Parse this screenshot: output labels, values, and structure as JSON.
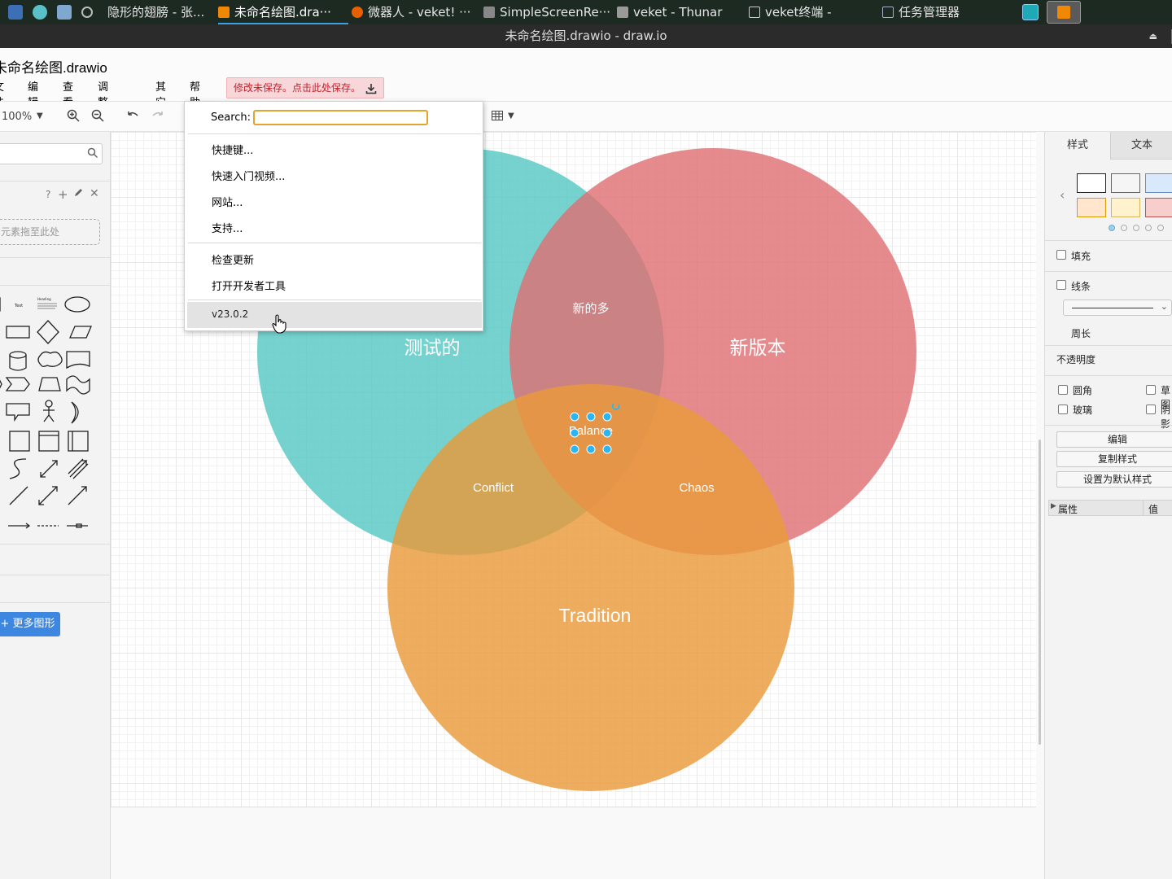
{
  "taskbar": {
    "tasks": [
      {
        "label": "隐形的翅膀 - 张..."
      },
      {
        "label": "未命名绘图.dra···"
      },
      {
        "label": "微器人 - veket! ···"
      },
      {
        "label": "SimpleScreenRe···"
      },
      {
        "label": "veket - Thunar"
      },
      {
        "label": "veket终端 -"
      },
      {
        "label": "任务管理器"
      }
    ]
  },
  "window": {
    "title": "未命名绘图.drawio - draw.io",
    "eject": "⏏"
  },
  "app": {
    "doc_title": "未命名绘图.drawio",
    "menu": [
      "文件",
      "编辑",
      "查看",
      "调整图形",
      "其它",
      "帮助"
    ],
    "unsaved_notice": "修改未保存。点击此处保存。"
  },
  "toolbar": {
    "zoom": "100%"
  },
  "left_panel": {
    "scratch_drop": "元素拖至此处",
    "more_shapes": "+ 更多图形",
    "shape_labels": {
      "text": "Text",
      "heading": "Heading"
    }
  },
  "help_menu": {
    "search_label": "Search:",
    "search_value": "",
    "items": [
      "快捷键...",
      "快速入门视频...",
      "网站...",
      "支持..."
    ],
    "items2": [
      "检查更新",
      "打开开发者工具"
    ],
    "version": "v23.0.2"
  },
  "diagram": {
    "circles": [
      {
        "label": "测试的",
        "color": "#58c8c4"
      },
      {
        "label": "新版本",
        "color": "#e06e70"
      },
      {
        "label": "Tradition",
        "color": "#e99a3a"
      }
    ],
    "intersections": {
      "top": "新的多",
      "left": "Conflict",
      "right": "Chaos",
      "center": "Balance"
    }
  },
  "right_panel": {
    "tabs": [
      "样式",
      "文本"
    ],
    "fill": "填充",
    "line": "线条",
    "perimeter": "周长",
    "opacity": "不透明度",
    "rounded": "圆角",
    "sketch": "草图",
    "glass": "玻璃",
    "shadow": "阴影",
    "edit": "编辑",
    "copy_style": "复制样式",
    "set_default": "设置为默认样式",
    "prop_col": "属性",
    "val_col": "值"
  }
}
